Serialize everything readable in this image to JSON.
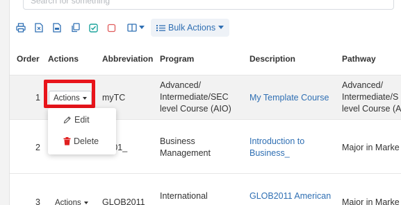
{
  "search": {
    "placeholder": "Search for something"
  },
  "toolbar": {
    "icons": [
      "print-icon",
      "excel-icon",
      "pdf-icon",
      "copy-icon",
      "check-icon",
      "square-icon",
      "columns-icon"
    ],
    "bulk_actions_label": "Bulk Actions"
  },
  "table": {
    "headers": {
      "order": "Order",
      "actions": "Actions",
      "abbreviation": "Abbreviation",
      "program": "Program",
      "description": "Description",
      "pathway": "Pathway"
    },
    "rows": [
      {
        "order": "1",
        "actions_label": "Actions",
        "abbreviation": "myTC",
        "program": [
          "Advanced/",
          "Intermediate/SEC",
          "level Course (AIO)"
        ],
        "description": [
          "My Template Course"
        ],
        "pathway": [
          "Advanced/",
          "Intermediate/S",
          "level Course (AI"
        ]
      },
      {
        "order": "2",
        "actions_label": "Actions",
        "abbreviation": "S101_",
        "program": [
          "Business",
          "Management"
        ],
        "description": [
          "Introduction to",
          "Business_"
        ],
        "pathway": [
          "Major in Marke"
        ]
      },
      {
        "order": "3",
        "actions_label": "Actions",
        "abbreviation": "GLOB2011",
        "program": [
          "International"
        ],
        "description": [
          "GLOB2011 American"
        ],
        "pathway": [
          "Major in Marke"
        ]
      }
    ]
  },
  "dropdown": {
    "edit_label": "Edit",
    "delete_label": "Delete",
    "delete_icon_color": "#e02020"
  },
  "colors": {
    "link": "#2f6fb3",
    "highlight": "#e8141a",
    "accent": "#2f6fb3"
  }
}
